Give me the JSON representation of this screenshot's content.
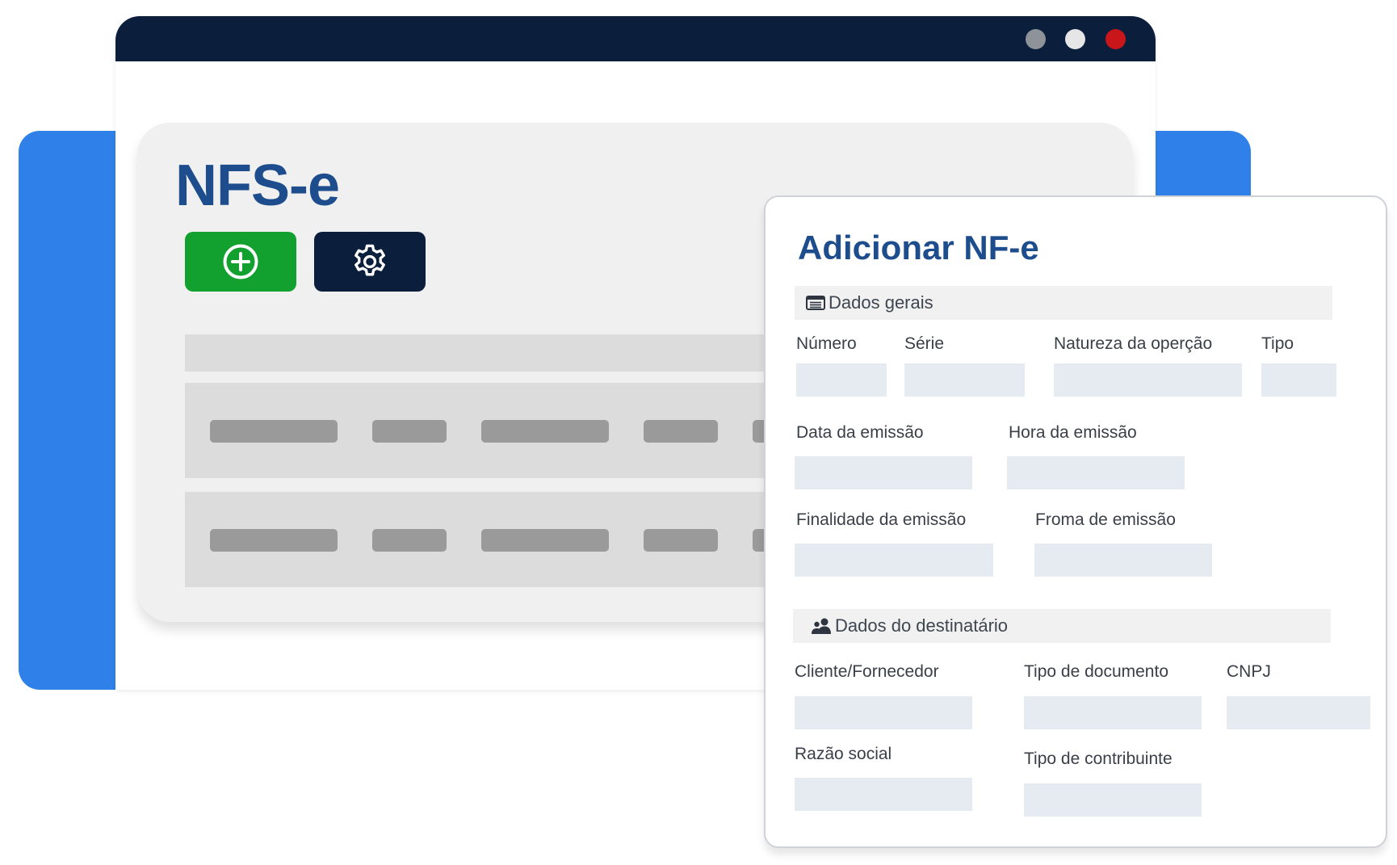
{
  "window": {
    "controls": {
      "minimize_color": "#8e9299",
      "maximize_color": "#e6e6e6",
      "close_color": "#c8161a"
    }
  },
  "app": {
    "title": "NFS-e",
    "buttons": {
      "add_icon": "plus-circle-icon",
      "settings_icon": "gear-icon"
    }
  },
  "modal": {
    "title": "Adicionar NF-e",
    "sections": {
      "general": {
        "label": "Dados gerais",
        "icon": "list-icon",
        "fields": {
          "numero": "Número",
          "serie": "Série",
          "natureza": "Natureza da operção",
          "tipo": "Tipo",
          "data_emissao": "Data da emissão",
          "hora_emissao": "Hora da emissão",
          "finalidade": "Finalidade da emissão",
          "forma": "Froma de emissão"
        }
      },
      "recipient": {
        "label": "Dados do destinatário",
        "icon": "users-icon",
        "fields": {
          "cliente": "Cliente/Fornecedor",
          "tipo_documento": "Tipo de documento",
          "cnpj": "CNPJ",
          "razao_social": "Razão social",
          "tipo_contribuinte": "Tipo de contribuinte"
        }
      }
    }
  },
  "colors": {
    "brand_blue": "#1d4d8d",
    "backdrop_blue": "#2f80e8",
    "navy": "#0b1f3d",
    "green": "#12a02f"
  }
}
